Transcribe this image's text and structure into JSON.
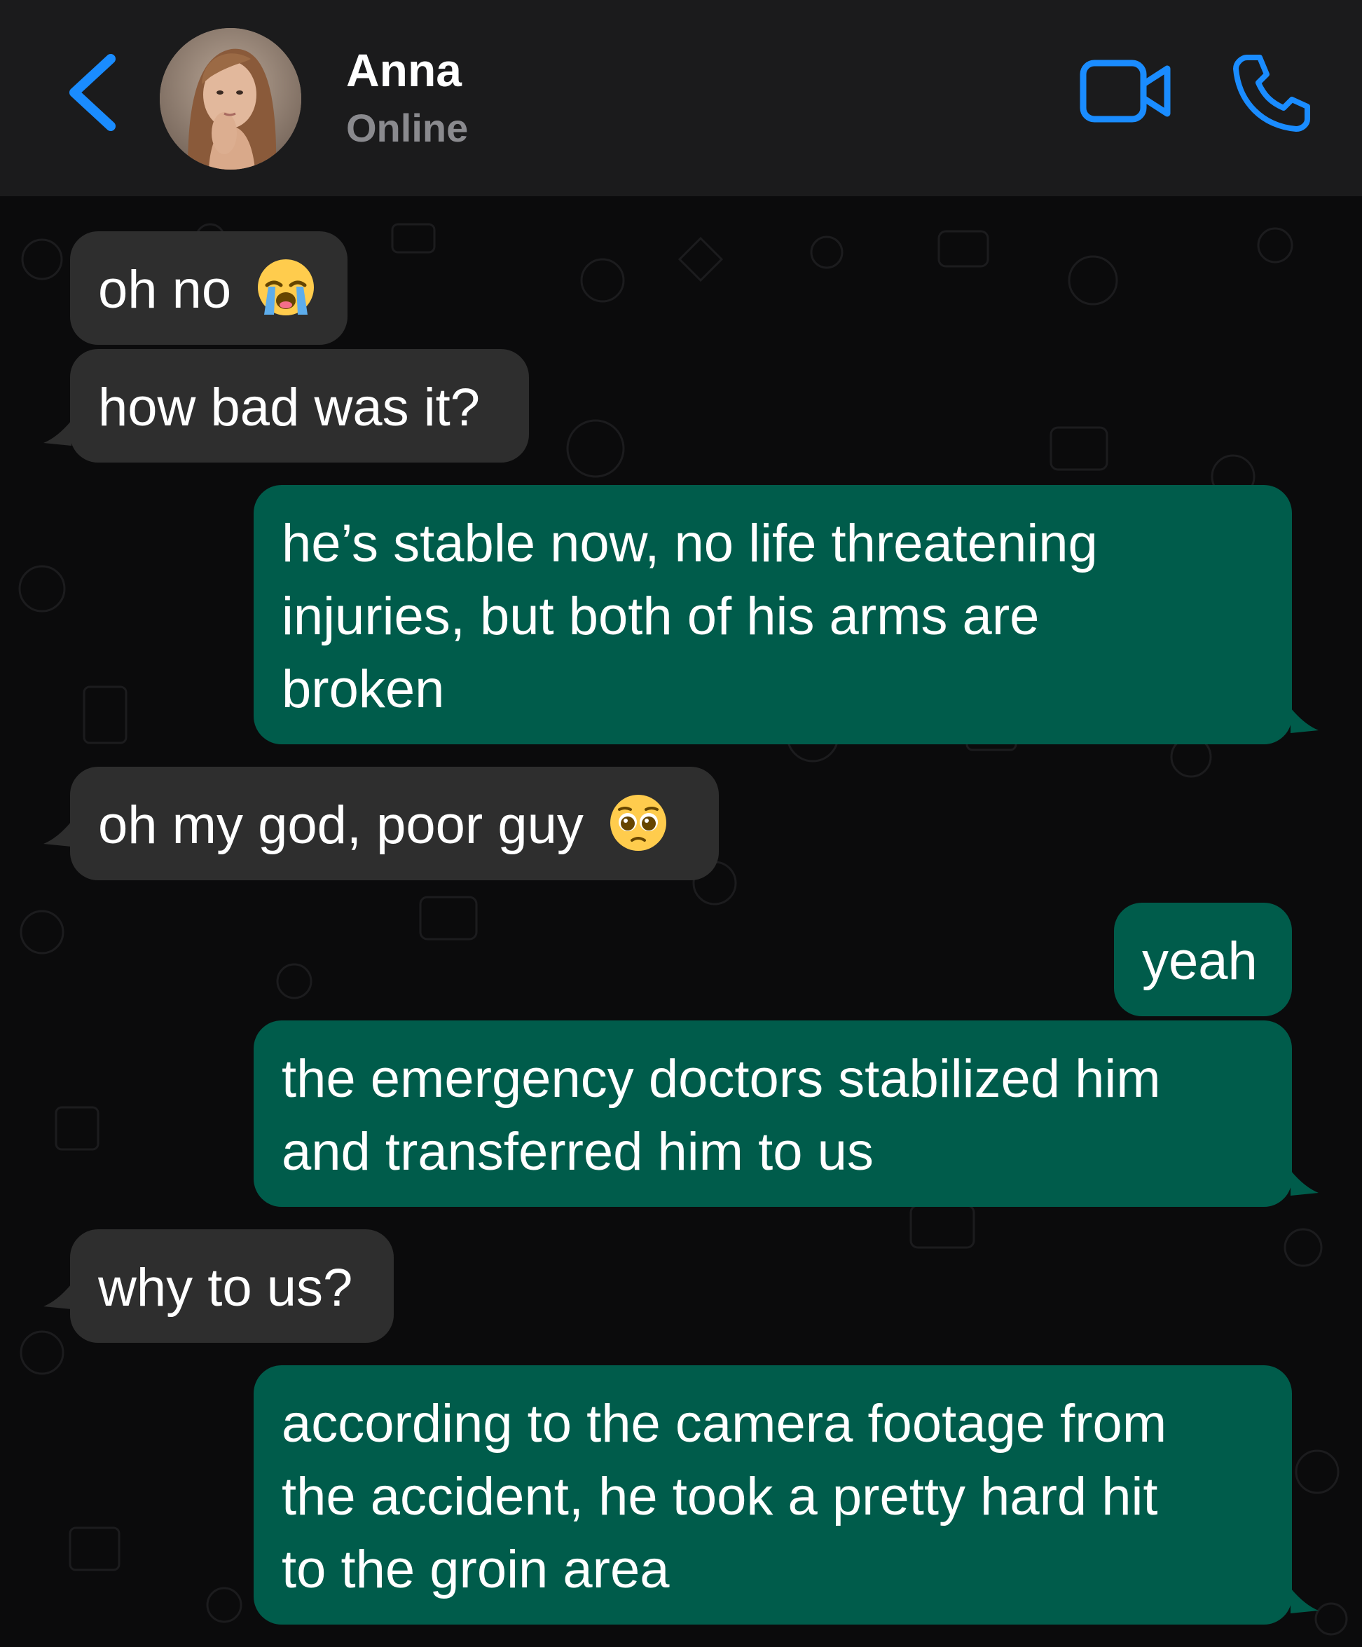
{
  "header": {
    "contact_name": "Anna",
    "status": "Online",
    "background_color": "#1b1b1c",
    "accent_color": "#1a8cff",
    "icons": {
      "back": "chevron-left-icon",
      "video": "video-camera-icon",
      "call": "phone-icon"
    }
  },
  "chat": {
    "background_color": "#0b0b0c",
    "incoming_bubble_color": "#2e2e2e",
    "outgoing_bubble_color": "#005c4b",
    "messages": [
      {
        "direction": "incoming",
        "lines": [
          "oh no"
        ],
        "emoji": "😭"
      },
      {
        "direction": "incoming",
        "lines": [
          "how bad was it?"
        ]
      },
      {
        "direction": "outgoing",
        "lines": [
          "he’s stable now, no life threatening",
          "injuries, but both of his arms are",
          "broken"
        ]
      },
      {
        "direction": "incoming",
        "lines": [
          "oh my god, poor guy"
        ],
        "emoji": "🥺"
      },
      {
        "direction": "outgoing",
        "lines": [
          "yeah"
        ]
      },
      {
        "direction": "outgoing",
        "lines": [
          "the emergency doctors stabilized him",
          "and transferred him to us"
        ]
      },
      {
        "direction": "incoming",
        "lines": [
          "why to us?"
        ]
      },
      {
        "direction": "outgoing",
        "lines": [
          "according to the camera footage from",
          "the accident, he took a pretty hard hit",
          "to the groin area"
        ]
      }
    ]
  }
}
